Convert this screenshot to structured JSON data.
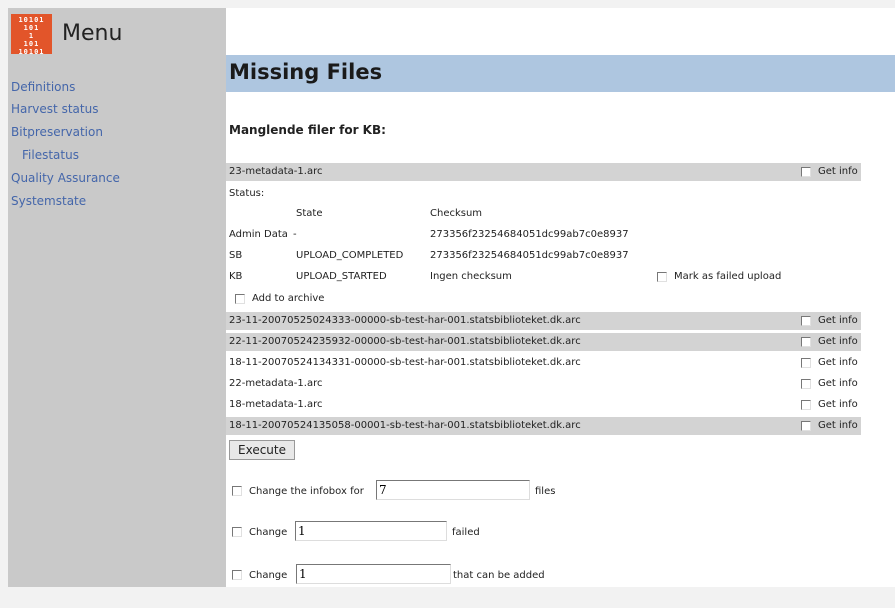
{
  "sidebar": {
    "logo_text": "10101\n101\n1\n101\n10101",
    "title": "Menu",
    "items": [
      {
        "label": "Definitions"
      },
      {
        "label": "Harvest status"
      },
      {
        "label": "Bitpreservation"
      },
      {
        "label": "Filestatus"
      },
      {
        "label": "Quality Assurance"
      },
      {
        "label": "Systemstate"
      }
    ]
  },
  "main": {
    "title": "Missing Files",
    "subheading": "Manglende filer for KB:",
    "first_file": "23-metadata-1.arc",
    "get_info_label": "Get info",
    "status_label": "Status:",
    "status_headers": {
      "state": "State",
      "checksum": "Checksum"
    },
    "status_rows": [
      {
        "location": "Admin Data",
        "state": "-",
        "checksum": "273356f23254684051dc99ab7c0e8937"
      },
      {
        "location": "SB",
        "state": "UPLOAD_COMPLETED",
        "checksum": "273356f23254684051dc99ab7c0e8937"
      },
      {
        "location": "KB",
        "state": "UPLOAD_STARTED",
        "checksum": "Ingen checksum"
      }
    ],
    "mark_failed_label": "Mark as failed upload",
    "add_to_archive_label": "Add to archive",
    "files": [
      "23-11-20070525024333-00000-sb-test-har-001.statsbiblioteket.dk.arc",
      "22-11-20070524235932-00000-sb-test-har-001.statsbiblioteket.dk.arc",
      "18-11-20070524134331-00000-sb-test-har-001.statsbiblioteket.dk.arc",
      "22-metadata-1.arc",
      "18-metadata-1.arc",
      "18-11-20070524135058-00001-sb-test-har-001.statsbiblioteket.dk.arc"
    ],
    "execute_label": "Execute",
    "change_infobox": {
      "prefix": "Change the infobox for",
      "value": "7",
      "suffix": "files"
    },
    "change_failed": {
      "prefix": "Change",
      "value": "1",
      "suffix": "failed"
    },
    "change_added": {
      "prefix": "Change",
      "value": "1",
      "suffix": "that can be added"
    }
  },
  "colors": {
    "title_bar": "#aec6e0",
    "sidebar": "#c9c9c9",
    "link": "#4466aa",
    "logo": "#e2552a",
    "row_gray": "#d3d3d3"
  }
}
